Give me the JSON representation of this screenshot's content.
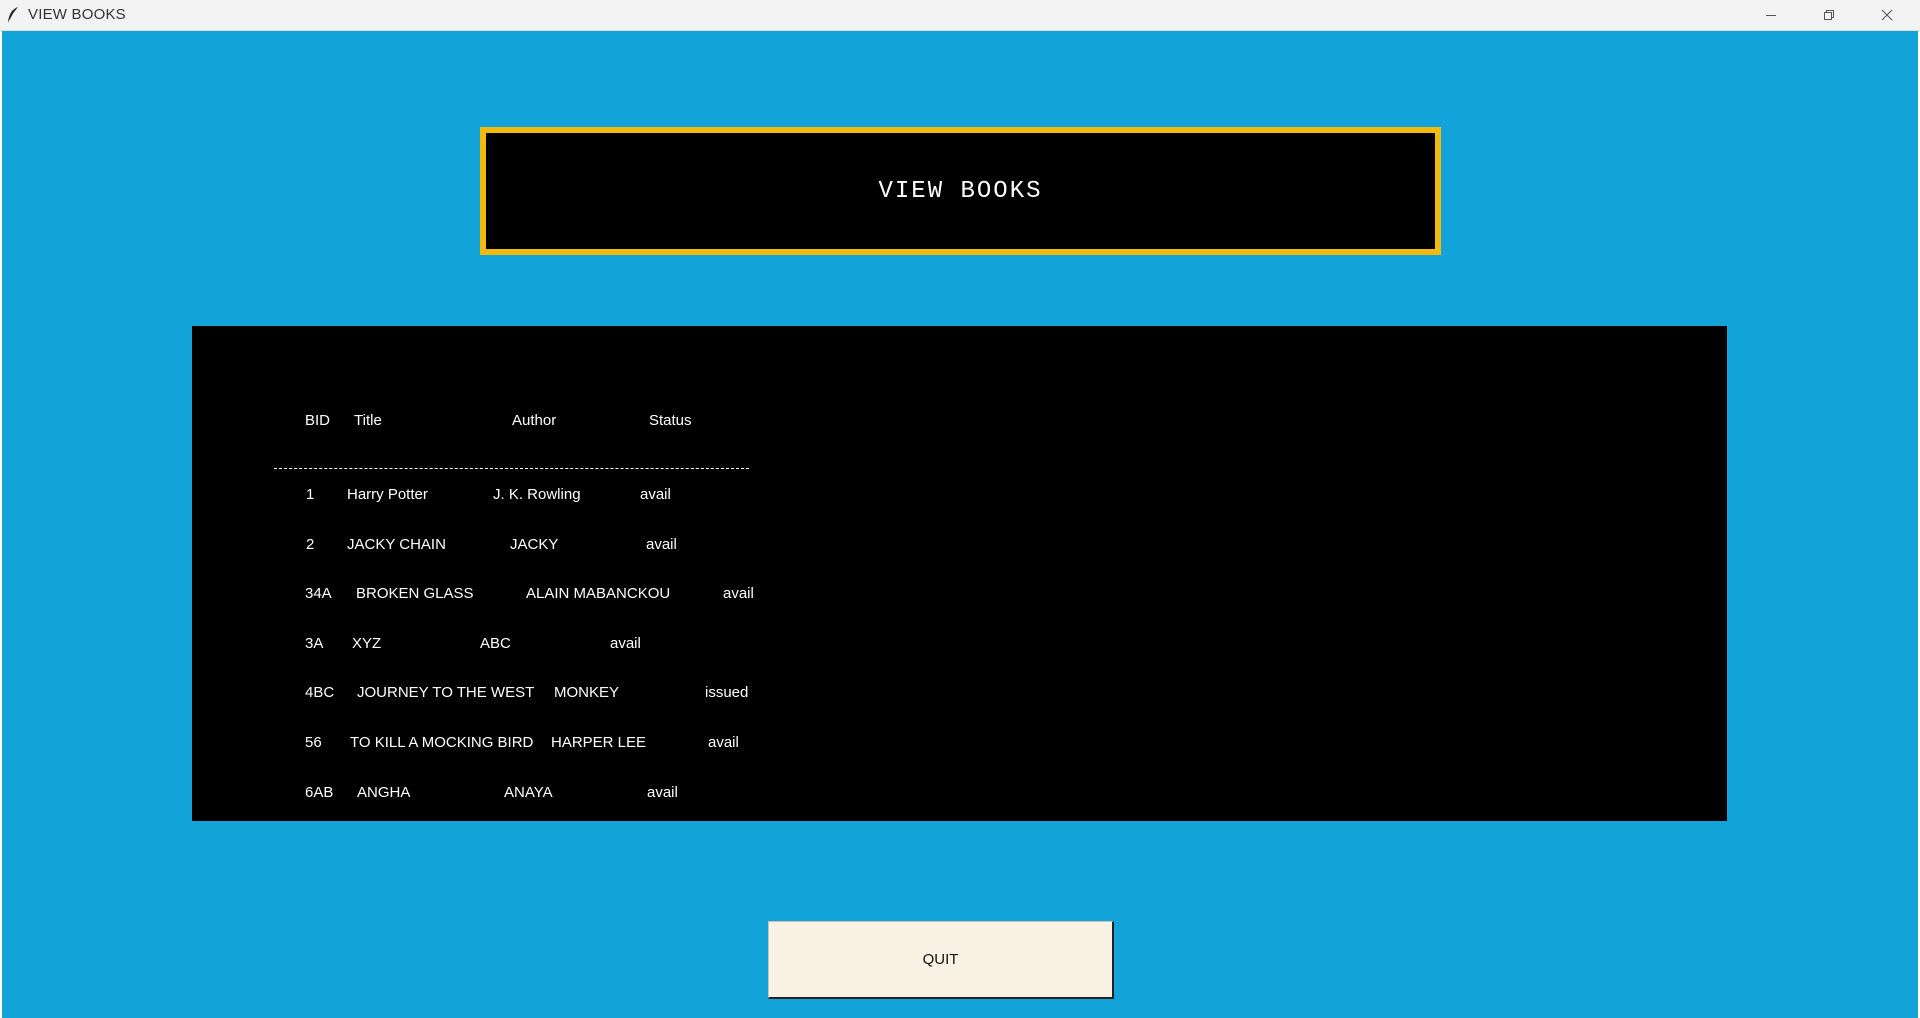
{
  "window": {
    "title": "VIEW BOOKS",
    "controls": [
      "minimize-icon",
      "restore-icon",
      "close-icon"
    ]
  },
  "heading": {
    "text": "VIEW BOOKS"
  },
  "table": {
    "headers": {
      "bid": "BID",
      "title": "Title",
      "author": "Author",
      "status": "Status"
    },
    "divider": "------------------------------------------------------------------------------------",
    "rows": [
      {
        "bid": "1",
        "title": "Harry Potter",
        "author": "J. K. Rowling",
        "status": "avail"
      },
      {
        "bid": "2",
        "title": "JACKY CHAIN",
        "author": "JACKY",
        "status": "avail"
      },
      {
        "bid": "34A",
        "title": "BROKEN GLASS",
        "author": "ALAIN MABANCKOU",
        "status": "avail"
      },
      {
        "bid": "3A",
        "title": "XYZ",
        "author": "ABC",
        "status": "avail"
      },
      {
        "bid": "4BC",
        "title": "JOURNEY TO THE WEST",
        "author": "MONKEY",
        "status": "issued"
      },
      {
        "bid": "56",
        "title": "TO KILL A MOCKING BIRD",
        "author": "HARPER LEE",
        "status": "avail"
      },
      {
        "bid": "6AB",
        "title": "ANGHA",
        "author": "ANAYA",
        "status": "avail"
      }
    ]
  },
  "quit_button": {
    "label": "QUIT"
  },
  "colors": {
    "background": "#12a3d8",
    "heading_border": "#f2b90f",
    "panel": "#000000",
    "button": "#f8f1e4",
    "text_light": "#ffffff"
  }
}
